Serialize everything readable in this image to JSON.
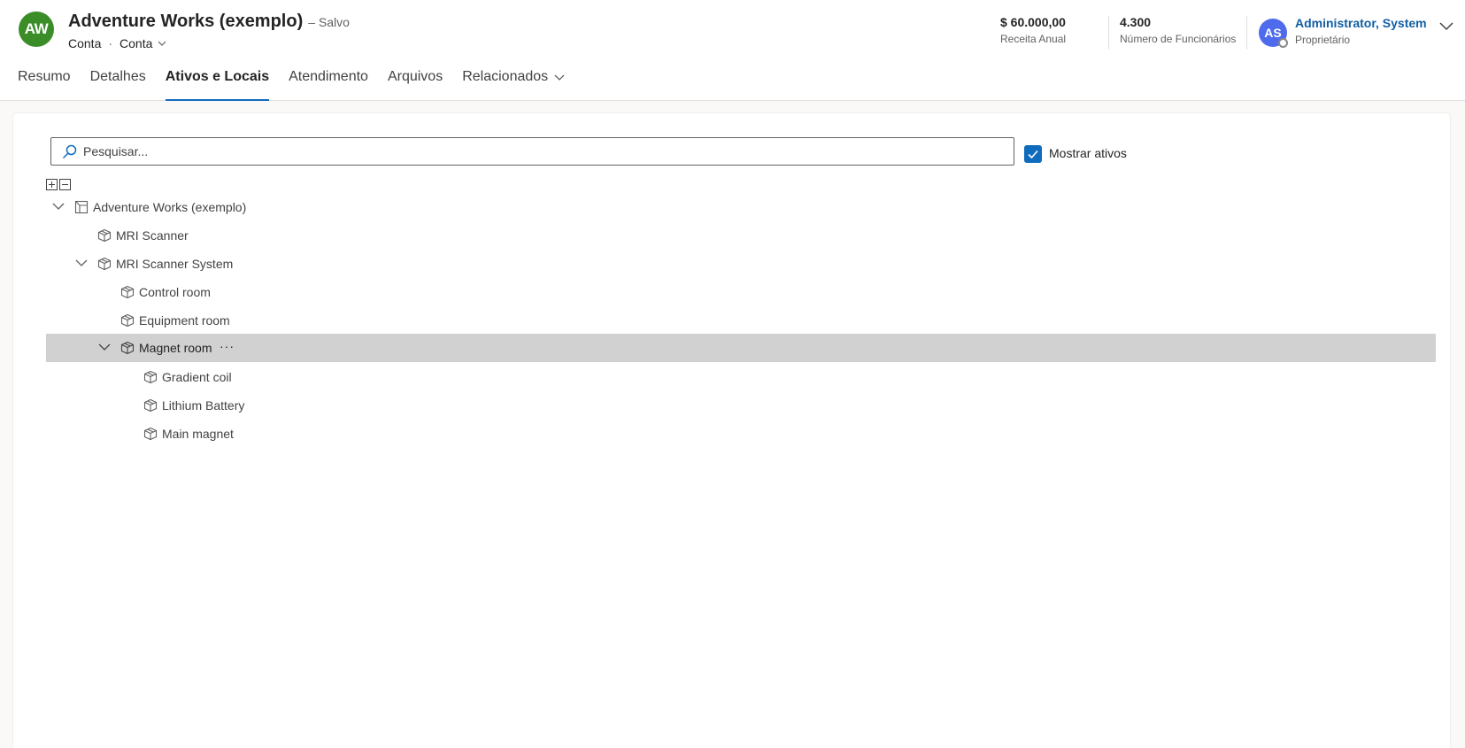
{
  "header": {
    "avatar_initials": "AW",
    "avatar_color": "#3b8d28",
    "title": "Adventure Works (exemplo)",
    "saved_status": "– Salvo",
    "breadcrumb": {
      "entity": "Conta",
      "separator": "·",
      "form": "Conta"
    },
    "kpis": [
      {
        "value": "$ 60.000,00",
        "label": "Receita Anual"
      },
      {
        "value": "4.300",
        "label": "Número de Funcionários"
      }
    ],
    "owner": {
      "initials": "AS",
      "name": "Administrator, System",
      "role": "Proprietário",
      "avatar_color": "#4f6bed"
    }
  },
  "tabs": [
    {
      "label": "Resumo",
      "active": false
    },
    {
      "label": "Detalhes",
      "active": false
    },
    {
      "label": "Ativos e Locais",
      "active": true
    },
    {
      "label": "Atendimento",
      "active": false
    },
    {
      "label": "Arquivos",
      "active": false
    },
    {
      "label": "Relacionados",
      "active": false,
      "has_dropdown": true
    }
  ],
  "search": {
    "placeholder": "Pesquisar...",
    "value": ""
  },
  "show_assets": {
    "label": "Mostrar ativos",
    "checked": true
  },
  "tree": [
    {
      "label": "Adventure Works (exemplo)",
      "icon": "account-icon",
      "level": 0,
      "expanded": true
    },
    {
      "label": "MRI Scanner",
      "icon": "asset-icon",
      "level": 1
    },
    {
      "label": "MRI Scanner System",
      "icon": "asset-icon",
      "level": 1,
      "expanded": true
    },
    {
      "label": "Control room",
      "icon": "asset-icon",
      "level": 2
    },
    {
      "label": "Equipment room",
      "icon": "asset-icon",
      "level": 2
    },
    {
      "label": "Magnet room",
      "icon": "asset-icon",
      "level": 2,
      "expanded": true,
      "selected": true,
      "more": "···"
    },
    {
      "label": "Gradient coil",
      "icon": "asset-icon",
      "level": 3
    },
    {
      "label": "Lithium Battery",
      "icon": "asset-icon",
      "level": 3
    },
    {
      "label": "Main magnet",
      "icon": "asset-icon",
      "level": 3
    }
  ],
  "colors": {
    "accent": "#0f6cbd",
    "selected_row": "#d1d1d1",
    "link": "#115ea3"
  }
}
